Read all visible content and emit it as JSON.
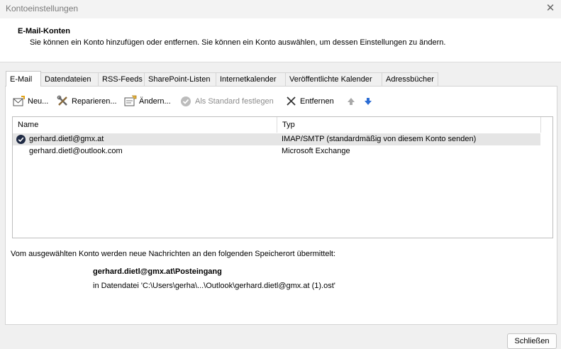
{
  "window": {
    "title": "Kontoeinstellungen",
    "close_label": "✕"
  },
  "header": {
    "title": "E-Mail-Konten",
    "subtitle": "Sie können ein Konto hinzufügen oder entfernen. Sie können ein Konto auswählen, um dessen Einstellungen zu ändern."
  },
  "tabs": [
    {
      "label": "E-Mail",
      "active": true
    },
    {
      "label": "Datendateien"
    },
    {
      "label": "RSS-Feeds"
    },
    {
      "label": "SharePoint-Listen"
    },
    {
      "label": "Internetkalender"
    },
    {
      "label": "Veröffentlichte Kalender"
    },
    {
      "label": "Adressbücher"
    }
  ],
  "toolbar": {
    "new_label": "Neu...",
    "repair_label": "Reparieren...",
    "change_label": "Ändern...",
    "default_label": "Als Standard festlegen",
    "remove_label": "Entfernen"
  },
  "list": {
    "columns": [
      "Name",
      "Typ"
    ],
    "rows": [
      {
        "name": "gerhard.dietl@gmx.at",
        "type": "IMAP/SMTP (standardmäßig von diesem Konto senden)",
        "default": true
      },
      {
        "name": "gerhard.dietl@outlook.com",
        "type": "Microsoft Exchange"
      }
    ]
  },
  "delivery": {
    "text": "Vom ausgewählten Konto werden neue Nachrichten an den folgenden Speicherort übermittelt:",
    "folder": "gerhard.dietl@gmx.at\\Posteingang",
    "datafile": "in Datendatei 'C:\\Users\\gerha\\...\\Outlook\\gerhard.dietl@gmx.at (1).ost'"
  },
  "footer": {
    "close_label": "Schließen"
  },
  "colors": {
    "accent_blue": "#2b6cd4",
    "selected_row": "#e5e5e5"
  }
}
